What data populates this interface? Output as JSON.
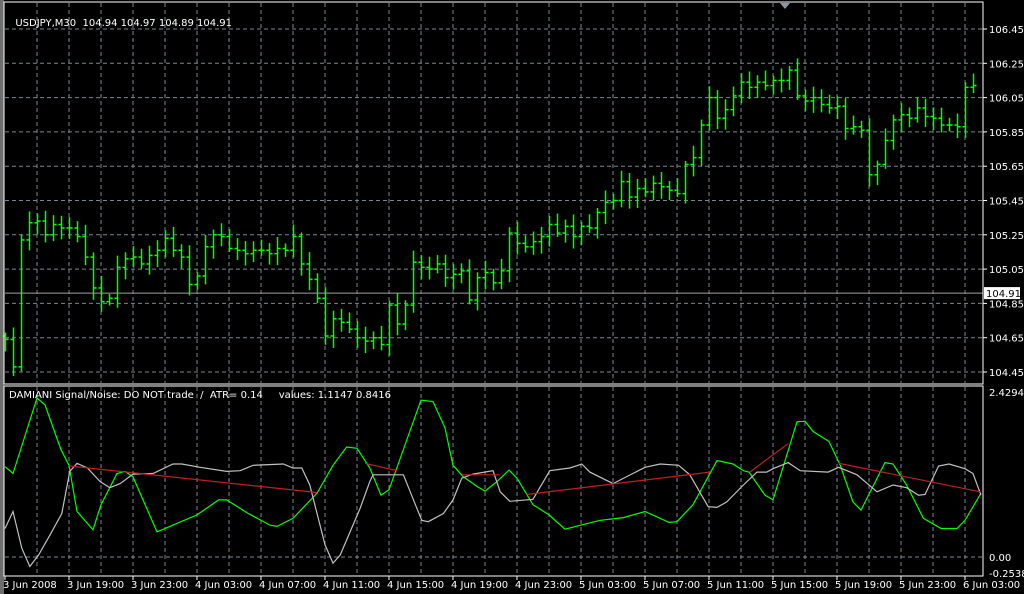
{
  "header": {
    "symbol": "USDJPY,M30",
    "ohlc": "104.94 104.97 104.89 104.91"
  },
  "indicator": {
    "label": "DAMIANI Signal/Noise: DO NOT trade  /  ATR= 0.14     values: 1.1147 0.8416",
    "scale_max": "2.4294",
    "scale_zero": "0.00",
    "scale_min": "-0.2538"
  },
  "price_axis": {
    "labels": [
      "106.45",
      "106.25",
      "106.05",
      "105.85",
      "105.65",
      "105.45",
      "105.25",
      "105.05",
      "104.85",
      "104.65",
      "104.45"
    ],
    "bid_label": "104.91"
  },
  "time_axis": {
    "labels": [
      "3 Jun 2008",
      "3 Jun 19:00",
      "3 Jun 23:00",
      "4 Jun 03:00",
      "4 Jun 07:00",
      "4 Jun 11:00",
      "4 Jun 15:00",
      "4 Jun 19:00",
      "4 Jun 23:00",
      "5 Jun 03:00",
      "5 Jun 07:00",
      "5 Jun 11:00",
      "5 Jun 15:00",
      "5 Jun 19:00",
      "5 Jun 23:00",
      "6 Jun 03:00"
    ]
  },
  "colors": {
    "background": "#000000",
    "bars": "#00ff00",
    "grid": "#7a8694",
    "signal_line": "#00ff00",
    "noise_line": "#c0c0c0",
    "trend_line": "#c02020",
    "bid_line": "#a0a0a0"
  },
  "chart_data": {
    "type": "line",
    "price": {
      "ylim": [
        104.45,
        106.45
      ],
      "bid": 104.91,
      "first_open": 104.66,
      "closes": [
        104.64,
        104.48,
        105.22,
        105.32,
        105.33,
        105.25,
        105.31,
        105.29,
        105.29,
        105.24,
        105.12,
        104.94,
        104.86,
        104.88,
        105.06,
        105.11,
        105.12,
        105.08,
        105.13,
        105.16,
        105.23,
        105.16,
        105.12,
        104.96,
        105.01,
        105.18,
        105.25,
        105.24,
        105.17,
        105.16,
        105.14,
        105.16,
        105.16,
        105.14,
        105.17,
        105.16,
        105.24,
        105.08,
        104.99,
        104.88,
        104.66,
        104.76,
        104.74,
        104.7,
        104.65,
        104.63,
        104.65,
        104.61,
        104.84,
        104.73,
        104.84,
        105.09,
        105.06,
        105.05,
        105.08,
        105.0,
        105.02,
        105.04,
        104.87,
        105.0,
        105.03,
        104.97,
        105.04,
        105.26,
        105.2,
        105.18,
        105.21,
        105.24,
        105.31,
        105.26,
        105.3,
        105.24,
        105.3,
        105.29,
        105.38,
        105.44,
        105.45,
        105.56,
        105.47,
        105.52,
        105.5,
        105.55,
        105.53,
        105.51,
        105.49,
        105.66,
        105.7,
        105.89,
        106.05,
        105.93,
        105.98,
        106.06,
        106.14,
        106.11,
        106.14,
        106.12,
        106.15,
        106.15,
        106.21,
        106.06,
        106.03,
        106.05,
        106.01,
        105.99,
        106.0,
        105.87,
        105.88,
        105.86,
        105.6,
        105.66,
        105.8,
        105.92,
        105.95,
        105.93,
        105.99,
        105.94,
        105.93,
        105.89,
        105.89,
        105.88,
        106.11,
        106.12
      ]
    },
    "indicator": {
      "ylim": [
        -0.2538,
        2.4294
      ],
      "series": [
        {
          "name": "signal",
          "points": [
            [
              0,
              1.33
            ],
            [
              1,
              1.23
            ],
            [
              4,
              2.34
            ],
            [
              5,
              2.24
            ],
            [
              7,
              1.58
            ],
            [
              8,
              1.35
            ],
            [
              9,
              0.67
            ],
            [
              11,
              0.4
            ],
            [
              12,
              0.77
            ],
            [
              14,
              1.23
            ],
            [
              15,
              1.26
            ],
            [
              16,
              1.18
            ],
            [
              19,
              0.37
            ],
            [
              21,
              0.47
            ],
            [
              24,
              0.62
            ],
            [
              26.7,
              0.84
            ],
            [
              27.7,
              0.84
            ],
            [
              30.4,
              0.64
            ],
            [
              33.1,
              0.47
            ],
            [
              34,
              0.45
            ],
            [
              36,
              0.57
            ],
            [
              39,
              0.94
            ],
            [
              41,
              1.35
            ],
            [
              42.7,
              1.62
            ],
            [
              44,
              1.6
            ],
            [
              45.6,
              1.31
            ],
            [
              47,
              0.91
            ],
            [
              48,
              0.99
            ],
            [
              52,
              2.31
            ],
            [
              53.5,
              2.29
            ],
            [
              55,
              1.9
            ],
            [
              56,
              1.35
            ],
            [
              57.3,
              1.18
            ],
            [
              59,
              1.04
            ],
            [
              60,
              0.97
            ],
            [
              61.5,
              1.11
            ],
            [
              63,
              1.28
            ],
            [
              64,
              1.16
            ],
            [
              66,
              0.77
            ],
            [
              68,
              0.62
            ],
            [
              70,
              0.41
            ],
            [
              72,
              0.47
            ],
            [
              74.4,
              0.54
            ],
            [
              77.3,
              0.58
            ],
            [
              80,
              0.67
            ],
            [
              83,
              0.51
            ],
            [
              84,
              0.52
            ],
            [
              86,
              0.77
            ],
            [
              89,
              1.42
            ],
            [
              91,
              1.37
            ],
            [
              92.3,
              1.27
            ],
            [
              93,
              1.25
            ],
            [
              95,
              0.91
            ],
            [
              96,
              0.84
            ],
            [
              99,
              1.99
            ],
            [
              100,
              2.0
            ],
            [
              101,
              1.85
            ],
            [
              103,
              1.7
            ],
            [
              104.4,
              1.35
            ],
            [
              106,
              0.81
            ],
            [
              107,
              0.69
            ],
            [
              110,
              1.39
            ],
            [
              111,
              1.37
            ],
            [
              112.7,
              1.06
            ],
            [
              114.8,
              0.57
            ],
            [
              117,
              0.42
            ],
            [
              119,
              0.42
            ],
            [
              120,
              0.54
            ],
            [
              122,
              0.94
            ]
          ]
        },
        {
          "name": "noise",
          "points": [
            [
              0,
              0.42
            ],
            [
              1,
              0.67
            ],
            [
              2.1,
              0.13
            ],
            [
              3.1,
              -0.14
            ],
            [
              4.2,
              0.03
            ],
            [
              5.6,
              0.32
            ],
            [
              7.1,
              0.64
            ],
            [
              8.1,
              1.26
            ],
            [
              9,
              1.38
            ],
            [
              10.3,
              1.31
            ],
            [
              11.9,
              1.11
            ],
            [
              13.1,
              1.02
            ],
            [
              14.4,
              1.08
            ],
            [
              16,
              1.22
            ],
            [
              18.5,
              1.23
            ],
            [
              21,
              1.37
            ],
            [
              22.1,
              1.37
            ],
            [
              24.4,
              1.32
            ],
            [
              27.7,
              1.26
            ],
            [
              29.4,
              1.27
            ],
            [
              31,
              1.35
            ],
            [
              34.8,
              1.37
            ],
            [
              36,
              1.31
            ],
            [
              37.1,
              1.31
            ],
            [
              38.1,
              1.06
            ],
            [
              40,
              0.18
            ],
            [
              41,
              -0.09
            ],
            [
              41.9,
              0.03
            ],
            [
              44.4,
              0.72
            ],
            [
              45.6,
              1.11
            ],
            [
              46,
              1.21
            ],
            [
              49.8,
              1.21
            ],
            [
              51.3,
              0.77
            ],
            [
              52.1,
              0.54
            ],
            [
              52.9,
              0.52
            ],
            [
              54.8,
              0.64
            ],
            [
              56,
              0.84
            ],
            [
              57.1,
              1.16
            ],
            [
              58.5,
              1.22
            ],
            [
              61,
              1.27
            ],
            [
              61.9,
              0.96
            ],
            [
              63.1,
              0.82
            ],
            [
              66,
              0.85
            ],
            [
              68.1,
              1.27
            ],
            [
              70.6,
              1.31
            ],
            [
              72.1,
              1.37
            ],
            [
              73.1,
              1.25
            ],
            [
              76,
              1.08
            ],
            [
              80,
              1.32
            ],
            [
              81.9,
              1.37
            ],
            [
              84.2,
              1.35
            ],
            [
              85.6,
              1.21
            ],
            [
              87.9,
              0.74
            ],
            [
              89,
              0.73
            ],
            [
              90.2,
              0.81
            ],
            [
              92.3,
              1.06
            ],
            [
              94,
              1.25
            ],
            [
              95.2,
              1.25
            ],
            [
              96,
              1.3
            ],
            [
              97.9,
              1.39
            ],
            [
              99.4,
              1.27
            ],
            [
              102.9,
              1.25
            ],
            [
              104.2,
              1.32
            ],
            [
              106.5,
              1.21
            ],
            [
              109,
              0.96
            ],
            [
              111,
              1.06
            ],
            [
              112.7,
              1.02
            ],
            [
              114.2,
              0.91
            ],
            [
              115,
              0.92
            ],
            [
              116.7,
              1.34
            ],
            [
              118,
              1.37
            ],
            [
              120,
              1.3
            ],
            [
              121,
              1.23
            ],
            [
              122,
              0.91
            ]
          ]
        }
      ],
      "trend_segments": [
        [
          [
            8.1,
            1.34
          ],
          [
            39,
            0.95
          ]
        ],
        [
          [
            45,
            1.38
          ],
          [
            49,
            1.27
          ]
        ],
        [
          [
            57.1,
            1.21
          ],
          [
            61.9,
            1.21
          ]
        ],
        [
          [
            65.2,
            0.92
          ],
          [
            88.1,
            1.25
          ]
        ],
        [
          [
            93.1,
            1.25
          ],
          [
            97.9,
            1.67
          ]
        ],
        [
          [
            104.2,
            1.38
          ],
          [
            121.9,
            0.96
          ]
        ]
      ]
    }
  }
}
